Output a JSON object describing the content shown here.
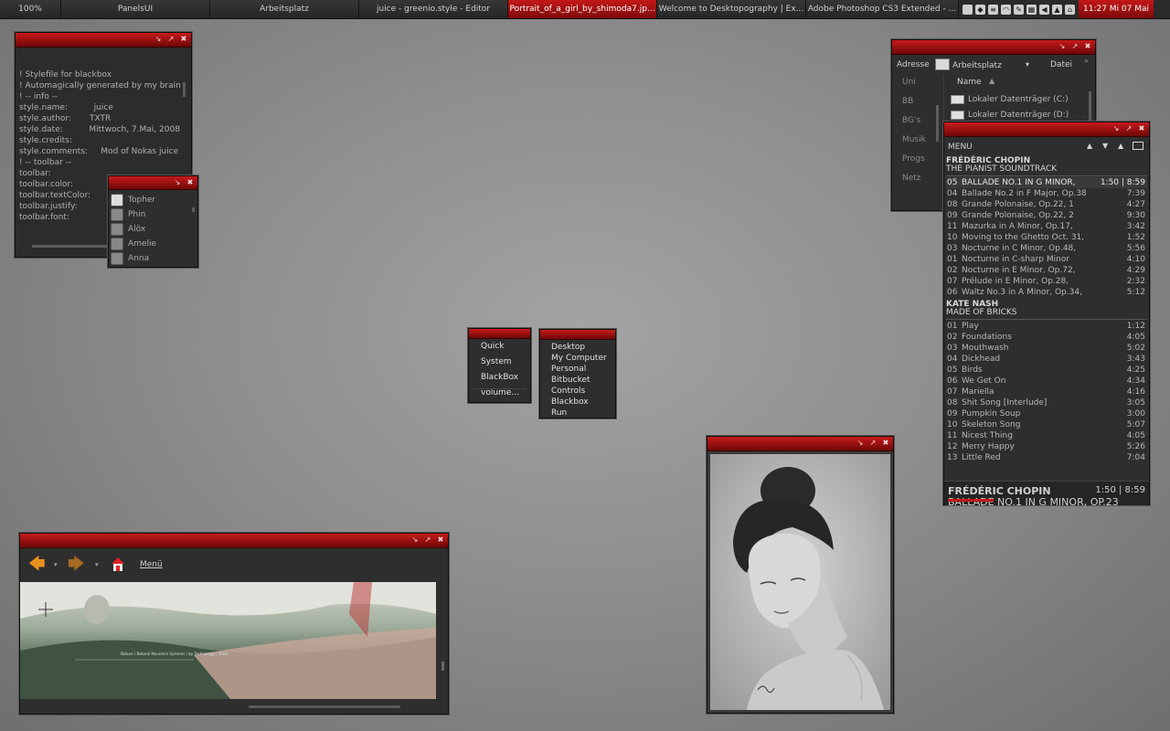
{
  "taskbar": {
    "items": [
      {
        "label": "100%",
        "w": 66
      },
      {
        "label": "PanelsUI",
        "w": 162
      },
      {
        "label": "Arbeitsplatz",
        "w": 162
      },
      {
        "label": "juice - greenio.style - Editor",
        "w": 162
      },
      {
        "label": "Portrait_of_a_girl_by_shimoda7.jp...",
        "w": 162,
        "active": true
      },
      {
        "label": "Welcome to Desktopography | Ex...",
        "w": 162
      },
      {
        "label": "Adobe Photoshop CS3 Extended - ...",
        "w": 166
      }
    ],
    "clock": "11:27   Mi 07 Mai"
  },
  "editor": {
    "lines": [
      "! Stylefile for blackbox",
      "! Automagically generated by my brain",
      "! -- info --",
      "style.name:          juice",
      "style.author:       TXTR",
      "style.date:          Mittwoch, 7.Mai, 2008",
      "style.credits:",
      "style.comments:     Mod of Nokas juice",
      "",
      "! -- toolbar --",
      "toolbar:",
      "toolbar.color:",
      "toolbar.textColor:",
      "toolbar.justify:",
      "toolbar.font:"
    ]
  },
  "contacts": {
    "items": [
      "Topher",
      "Phin",
      "Alöx",
      "Amelie",
      "Anna"
    ]
  },
  "bbmenu1": {
    "items": [
      "Quick",
      "System",
      "BlackBox",
      "volume..."
    ]
  },
  "bbmenu2": {
    "items": [
      "Desktop",
      "My Computer",
      "Personal",
      "Bitbucket",
      "Controls",
      "Blackbox",
      "Run"
    ]
  },
  "explorer": {
    "address_label": "Adresse",
    "address_value": "Arbeitsplatz",
    "file_menu": "Datei",
    "sidebar": [
      "Uni",
      "BB",
      "BG's",
      "Musik",
      "Progs",
      "Netz"
    ],
    "column_name": "Name",
    "drives": [
      "Lokaler Datenträger (C:)",
      "Lokaler Datenträger (D:)"
    ]
  },
  "player": {
    "menu_label": "MENU",
    "albums": [
      {
        "artist": "FRÉDÉRIC CHOPIN",
        "album": "THE PIANIST SOUNDTRACK",
        "tracks": [
          {
            "no": "05",
            "title": "BALLADE NO.1 IN G MINOR,",
            "time": "1:50  |   8:59",
            "current": true
          },
          {
            "no": "04",
            "title": "Ballade No.2 in F Major, Op.38",
            "time": "7:39"
          },
          {
            "no": "08",
            "title": "Grande Polonaise, Op.22, 1",
            "time": "4:27"
          },
          {
            "no": "09",
            "title": "Grande Polonaise, Op.22, 2",
            "time": "9:30"
          },
          {
            "no": "11",
            "title": "Mazurka in A Minor, Op.17,",
            "time": "3:42"
          },
          {
            "no": "10",
            "title": "Moving to the Ghetto Oct. 31,",
            "time": "1:52"
          },
          {
            "no": "03",
            "title": "Nocturne in C Minor, Op.48,",
            "time": "5:56"
          },
          {
            "no": "01",
            "title": "Nocturne in C-sharp Minor",
            "time": "4:10"
          },
          {
            "no": "02",
            "title": "Nocturne in E Minor, Op.72,",
            "time": "4:29"
          },
          {
            "no": "07",
            "title": "Prélude in E Minor, Op.28,",
            "time": "2:32"
          },
          {
            "no": "06",
            "title": "Waltz No.3 in A Minor, Op.34,",
            "time": "5:12"
          }
        ]
      },
      {
        "artist": "KATE NASH",
        "album": "MADE OF BRICKS",
        "tracks": [
          {
            "no": "01",
            "title": "Play",
            "time": "1:12"
          },
          {
            "no": "02",
            "title": "Foundations",
            "time": "4:05"
          },
          {
            "no": "03",
            "title": "Mouthwash",
            "time": "5:02"
          },
          {
            "no": "04",
            "title": "Dickhead",
            "time": "3:43"
          },
          {
            "no": "05",
            "title": "Birds",
            "time": "4:25"
          },
          {
            "no": "06",
            "title": "We Get On",
            "time": "4:34"
          },
          {
            "no": "07",
            "title": "Mariella",
            "time": "4:16"
          },
          {
            "no": "08",
            "title": "Shit Song [Interlude]",
            "time": "3:05"
          },
          {
            "no": "09",
            "title": "Pumpkin Soup",
            "time": "3:00"
          },
          {
            "no": "10",
            "title": "Skeleton Song",
            "time": "5:07"
          },
          {
            "no": "11",
            "title": "Nicest Thing",
            "time": "4:05"
          },
          {
            "no": "12",
            "title": "Merry Happy",
            "time": "5:26"
          },
          {
            "no": "13",
            "title": "Little Red",
            "time": "7:04"
          }
        ]
      }
    ],
    "now_artist": "FRÉDÉRIC CHOPIN",
    "now_title": "BALLADE NO.1 IN G MINOR, OP.23",
    "now_time": "1:50 | 8:59"
  },
  "browser": {
    "menu_label": "Menü",
    "map_text": "Nature / Natural Mountain Systems / by Technology / 2008"
  },
  "colors": {
    "accent": "#c41818",
    "panel": "#2e2e2e"
  }
}
